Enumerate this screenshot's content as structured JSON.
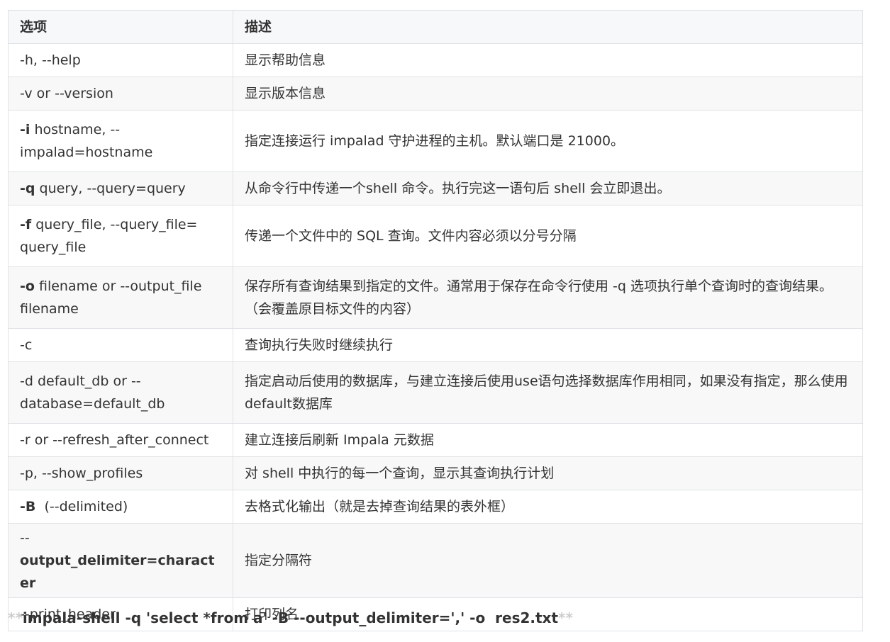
{
  "table": {
    "headers": [
      "选项",
      "描述"
    ],
    "rows": [
      {
        "flag": "",
        "option": "-h, --help",
        "desc": "显示帮助信息"
      },
      {
        "flag": "",
        "option": "-v or --version",
        "desc": "显示版本信息"
      },
      {
        "flag": "-i",
        "option": " hostname, --impalad=hostname",
        "desc": "指定连接运行 impalad 守护进程的主机。默认端口是 21000。"
      },
      {
        "flag": "-q",
        "option": " query, --query=query",
        "desc": "从命令行中传递一个shell 命令。执行完这一语句后 shell 会立即退出。"
      },
      {
        "flag": "-f",
        "option": " query_file, --query_file= query_file",
        "desc": "传递一个文件中的 SQL 查询。文件内容必须以分号分隔"
      },
      {
        "flag": "-o",
        "option": " filename or --output_file filename",
        "desc": "保存所有查询结果到指定的文件。通常用于保存在命令行使用 -q 选项执行单个查询时的查询结果。（会覆盖原目标文件的内容）"
      },
      {
        "flag": "",
        "option": "-c",
        "desc": "查询执行失败时继续执行"
      },
      {
        "flag": "",
        "option": "-d default_db or --database=default_db",
        "desc": "指定启动后使用的数据库，与建立连接后使用use语句选择数据库作用相同，如果没有指定，那么使用default数据库"
      },
      {
        "flag": "",
        "option": "-r or --refresh_after_connect",
        "desc": "建立连接后刷新 Impala 元数据"
      },
      {
        "flag": "",
        "option": "-p, --show_profiles",
        "desc": "对 shell 中执行的每一个查询，显示其查询执行计划"
      },
      {
        "flag": "-B",
        "option": "  (--delimited)",
        "desc": "去格式化输出（就是去掉查询结果的表外框）"
      },
      {
        "flag": "",
        "option": "--",
        "flag_after": "output_delimiter=character",
        "desc": "指定分隔符"
      },
      {
        "flag": "",
        "option": "--print_header",
        "desc": "打印列名"
      }
    ]
  },
  "command": {
    "open_mark": "**",
    "text": "impala-shell -q 'select *from a' -B --output_delimiter=',' -o  res2.txt",
    "close_mark": "**"
  }
}
